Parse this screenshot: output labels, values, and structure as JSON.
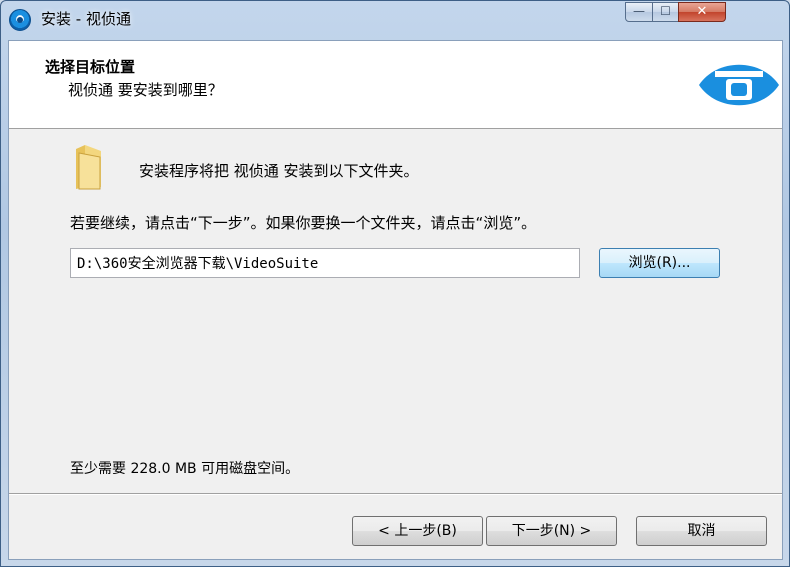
{
  "window": {
    "title": "安装 - 视侦通",
    "controls": {
      "minimize": "—",
      "maximize": "☐",
      "close": "✕"
    }
  },
  "header": {
    "title": "选择目标位置",
    "subtitle": "视侦通 要安装到哪里？",
    "logo_icon": "eye-logo-icon"
  },
  "body": {
    "folder_icon": "folder-icon",
    "description": "安装程序将把 视侦通 安装到以下文件夹。",
    "instruction": "若要继续，请点击“下一步”。如果你要换一个文件夹，请点击“浏览”。",
    "install_path": "D:\\360安全浏览器下载\\VideoSuite",
    "browse_label": "浏览(R)...",
    "space_required": "至少需要 228.0 MB 可用磁盘空间。"
  },
  "footer": {
    "back_label": "< 上一步(B)",
    "next_label": "下一步(N) >",
    "cancel_label": "取消"
  },
  "colors": {
    "accent_blue": "#1a8fdf",
    "title_bar": "#b9cde6"
  }
}
